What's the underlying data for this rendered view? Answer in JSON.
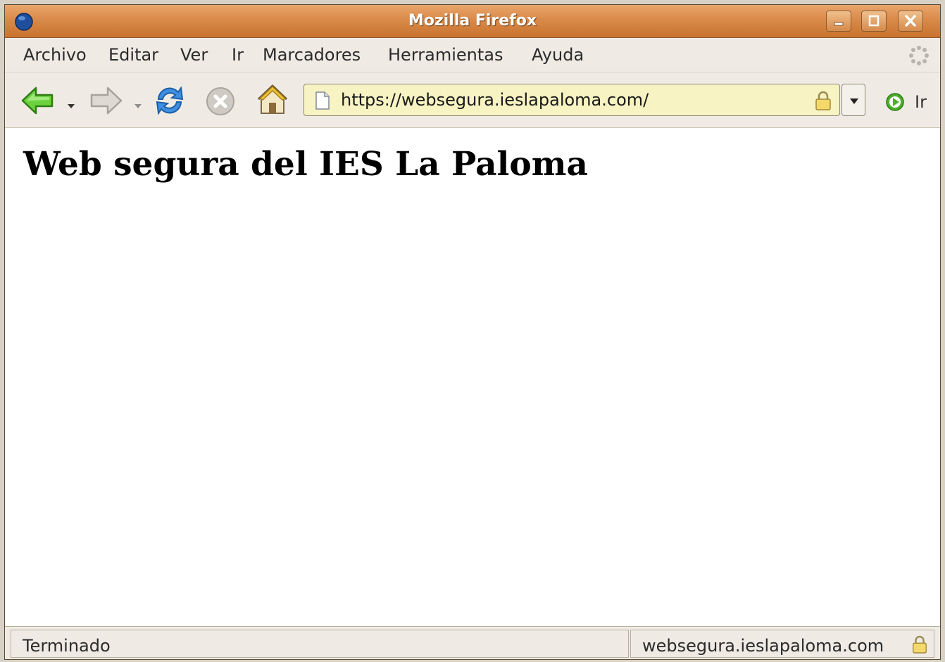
{
  "window": {
    "title": "Mozilla Firefox"
  },
  "menu": {
    "items": [
      "Archivo",
      "Editar",
      "Ver",
      "Ir",
      "Marcadores",
      "Herramientas",
      "Ayuda"
    ]
  },
  "toolbar": {
    "go_label": "Ir"
  },
  "address": {
    "url": "https://websegura.ieslapaloma.com/"
  },
  "page": {
    "heading": "Web segura del IES La Paloma"
  },
  "status": {
    "text": "Terminado",
    "host": "websegura.ieslapaloma.com"
  },
  "colors": {
    "titlebar": "#d98a49",
    "urlbar_secure": "#f8f3c3",
    "accent_green": "#4caf2a"
  },
  "icons": [
    "firefox-globe-icon",
    "minimize-icon",
    "maximize-icon",
    "close-icon",
    "throbber-icon",
    "back-arrow-icon",
    "forward-arrow-icon",
    "reload-icon",
    "stop-icon",
    "home-icon",
    "page-icon",
    "lock-icon",
    "go-icon"
  ]
}
